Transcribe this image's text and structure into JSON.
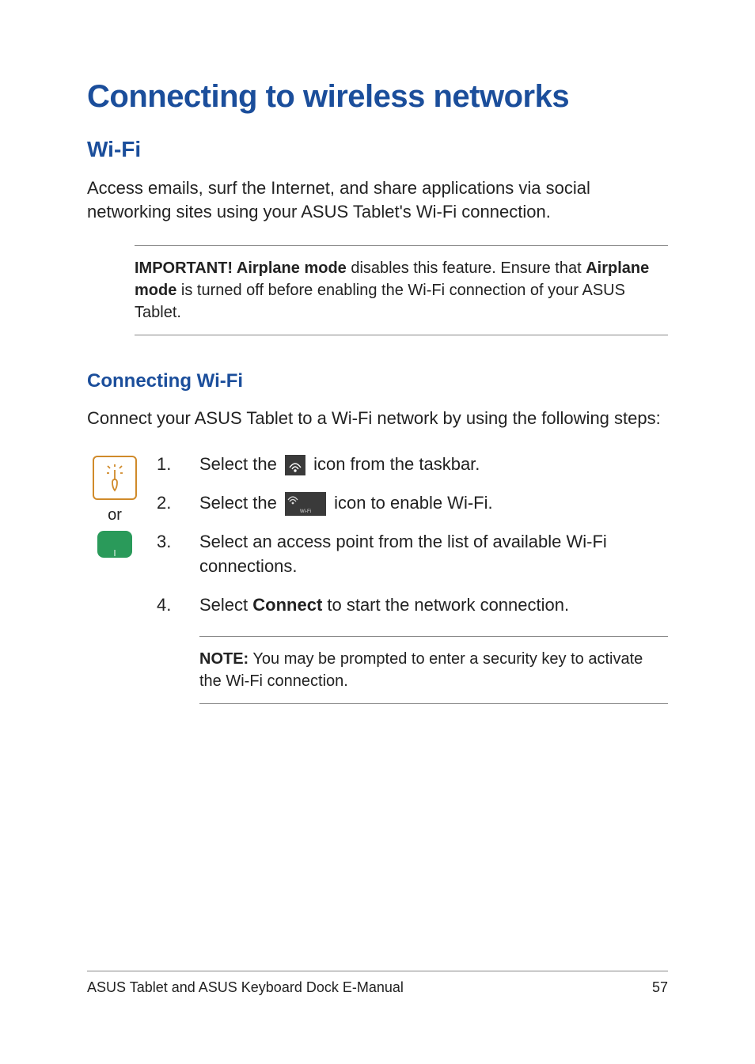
{
  "h1": "Connecting to wireless networks",
  "h2": "Wi-Fi",
  "intro": "Access emails, surf the Internet, and share applications via social networking sites using your ASUS Tablet's Wi-Fi connection.",
  "important": {
    "label": "IMPORTANT! ",
    "strong1": "Airplane mode",
    "mid": " disables this feature. Ensure that ",
    "strong2": "Airplane mode",
    "after": " is turned off before enabling the Wi-Fi connection of your ASUS Tablet."
  },
  "h3": "Connecting Wi-Fi",
  "lead": "Connect your ASUS Tablet to a Wi-Fi network by using the following steps:",
  "or": "or",
  "wifi_tile_label": "Wi-Fi",
  "steps": {
    "n1": "1.",
    "s1a": "Select the ",
    "s1b": " icon from the taskbar.",
    "n2": "2.",
    "s2a": "Select the ",
    "s2b": " icon to enable Wi-Fi.",
    "n3": "3.",
    "s3": "Select an access point from the list of available Wi-Fi connections.",
    "n4": "4.",
    "s4a": "Select ",
    "s4strong": "Connect",
    "s4b": " to start the network connection."
  },
  "note": {
    "label": "NOTE:",
    "text": " You may be prompted to enter a security key to activate the Wi-Fi connection."
  },
  "footer": {
    "title": "ASUS Tablet and ASUS Keyboard Dock E-Manual",
    "page": "57"
  }
}
